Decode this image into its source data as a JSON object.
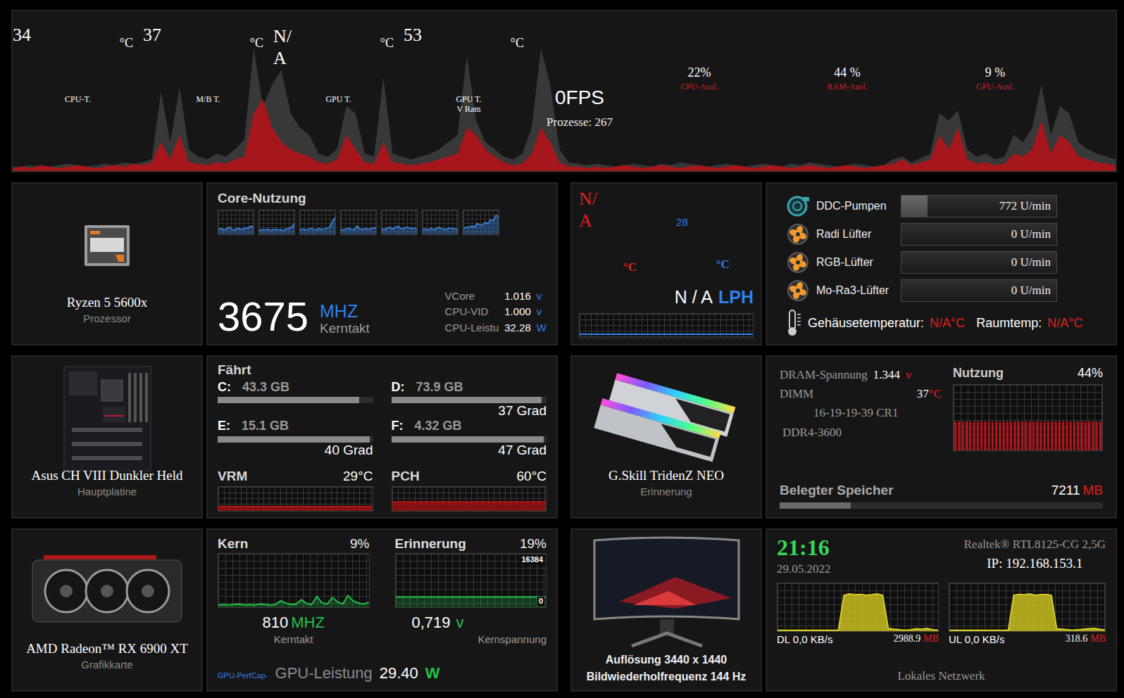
{
  "top": {
    "temps": [
      {
        "value": "34",
        "unit": "°C",
        "label": [
          "CPU-T."
        ],
        "kind": "plain"
      },
      {
        "value": "37",
        "unit": "°C",
        "label": [
          "M/B T."
        ],
        "kind": "plain"
      },
      {
        "value": "N/A",
        "unit": "°C",
        "label": [
          "GPU T."
        ],
        "kind": "stacked"
      },
      {
        "value": "53",
        "unit": "°C",
        "label": [
          "GPU T.",
          "V Ram"
        ],
        "kind": "plain"
      }
    ],
    "fps": "0FPS",
    "processes": "Prozesse: 267",
    "usage": [
      {
        "value": "22%",
        "label": "CPU-Ausl."
      },
      {
        "value": "44 %",
        "label": "RAM-Ausl."
      },
      {
        "value": "9 %",
        "label": "GPU-Ausl."
      }
    ],
    "chart": {
      "series": [
        {
          "color": "#3c3c3c",
          "values": [
            3,
            3,
            4,
            3,
            3,
            4,
            5,
            4,
            3,
            4,
            5,
            4,
            6,
            5,
            6,
            8,
            55,
            20,
            58,
            15,
            10,
            8,
            12,
            10,
            15,
            22,
            85,
            45,
            60,
            70,
            40,
            30,
            25,
            12,
            10,
            15,
            45,
            40,
            12,
            10,
            65,
            12,
            10,
            8,
            10,
            12,
            15,
            20,
            25,
            80,
            35,
            20,
            15,
            10,
            8,
            12,
            30,
            85,
            60,
            15,
            6,
            5,
            4,
            5,
            4,
            3,
            4,
            5,
            4,
            3,
            5,
            4,
            6,
            5,
            4,
            3,
            4,
            5,
            4,
            3,
            4,
            5,
            4,
            3,
            5,
            4,
            6,
            5,
            4,
            3,
            4,
            5,
            4,
            3,
            4,
            8,
            10,
            6,
            9,
            12,
            40,
            35,
            42,
            15,
            10,
            12,
            8,
            10,
            25,
            20,
            30,
            60,
            25,
            45,
            40,
            20,
            15,
            12,
            10,
            8
          ]
        },
        {
          "color": "#b3141a",
          "values": [
            2,
            3,
            2,
            4,
            3,
            2,
            3,
            4,
            3,
            2,
            3,
            4,
            3,
            5,
            4,
            6,
            20,
            8,
            25,
            6,
            5,
            4,
            6,
            5,
            8,
            10,
            40,
            50,
            30,
            20,
            15,
            12,
            10,
            6,
            5,
            8,
            25,
            15,
            6,
            5,
            20,
            6,
            5,
            4,
            5,
            6,
            8,
            10,
            12,
            30,
            25,
            15,
            10,
            6,
            4,
            5,
            12,
            30,
            20,
            6,
            3,
            3,
            2,
            3,
            2,
            3,
            4,
            3,
            2,
            3,
            4,
            3,
            2,
            3,
            4,
            3,
            2,
            3,
            4,
            3,
            2,
            3,
            4,
            3,
            2,
            3,
            4,
            3,
            2,
            3,
            4,
            3,
            2,
            3,
            4,
            5,
            8,
            4,
            6,
            8,
            25,
            15,
            30,
            8,
            5,
            6,
            4,
            5,
            12,
            10,
            15,
            35,
            12,
            25,
            20,
            10,
            8,
            6,
            5,
            4
          ]
        }
      ]
    }
  },
  "cpu": {
    "name": "Ryzen 5 5600x",
    "type": "Prozessor",
    "title": "Core-Nutzung",
    "cores": [
      {
        "values": [
          20,
          25,
          18,
          22,
          30,
          20,
          18,
          25,
          22,
          20,
          28,
          24,
          35,
          30
        ]
      },
      {
        "values": [
          15,
          20,
          18,
          22,
          17,
          19,
          21,
          18,
          20,
          16,
          22,
          25,
          30,
          45
        ]
      },
      {
        "values": [
          18,
          22,
          20,
          19,
          25,
          21,
          18,
          24,
          20,
          22,
          26,
          30,
          55,
          70
        ]
      },
      {
        "values": [
          20,
          18,
          22,
          25,
          20,
          18,
          35,
          22,
          20,
          24,
          21,
          23,
          28,
          25
        ]
      },
      {
        "values": [
          22,
          20,
          25,
          30,
          22,
          28,
          35,
          25,
          22,
          30,
          28,
          24,
          26,
          22
        ]
      },
      {
        "values": [
          20,
          22,
          18,
          25,
          20,
          22,
          30,
          24,
          20,
          22,
          26,
          24,
          22,
          20
        ]
      },
      {
        "values": [
          25,
          30,
          28,
          35,
          30,
          45,
          40,
          38,
          50,
          45,
          60,
          55,
          80,
          70
        ]
      }
    ],
    "clock": "3675",
    "clock_unit": "MHZ",
    "clock_label": "Kerntakt",
    "readings": [
      {
        "label": "VCore",
        "value": "1.016",
        "unit": "v"
      },
      {
        "label": "CPU-VID",
        "value": "1.000",
        "unit": "v"
      },
      {
        "label": "CPU-Leistu",
        "value": "32.28",
        "unit": "W"
      }
    ]
  },
  "cooling": {
    "temps": [
      {
        "value": "N/A",
        "unit": "°C",
        "color": "#e0201c",
        "kind": "stacked"
      },
      {
        "value": "28",
        "unit": "°C",
        "color": "#2f7ff0",
        "kind": "plain"
      }
    ],
    "flow": {
      "value": "N / A",
      "unit": "LPH"
    },
    "graph": [
      15,
      15,
      15,
      15,
      15,
      15,
      15,
      15,
      15,
      15,
      15,
      15,
      15,
      15,
      15,
      15
    ]
  },
  "fans": {
    "items": [
      {
        "name": "DDC-Pumpen",
        "reading": "772 U/min",
        "level": 0.17,
        "kind": "pump"
      },
      {
        "name": "Radi Lüfter",
        "reading": "0 U/min",
        "level": 0,
        "kind": "fan"
      },
      {
        "name": "RGB-Lüfter",
        "reading": "0 U/min",
        "level": 0,
        "kind": "fan"
      },
      {
        "name": "Mo-Ra3-Lüfter",
        "reading": "0 U/min",
        "level": 0,
        "kind": "fan"
      }
    ],
    "case_label": "Gehäusetemperatur:",
    "case_value": "N/A°C",
    "room_label": "Raumtemp:",
    "room_value": "N/A°C"
  },
  "board": {
    "name": "Asus CH VIII Dunkler Held",
    "type": "Hauptplatine",
    "drives_title": "Fährt",
    "drives": [
      {
        "letter": "C:",
        "size": "43.3 GB",
        "level": 0.91
      },
      {
        "letter": "D:",
        "size": "73.9 GB",
        "level": 0.97,
        "temp": "37 Grad"
      },
      {
        "letter": "E:",
        "size": "15.1 GB",
        "level": 0.98,
        "temp": "40 Grad"
      },
      {
        "letter": "F:",
        "size": "4.32 GB",
        "level": 0.98,
        "temp": "47 Grad"
      }
    ],
    "sensors": [
      {
        "label": "VRM",
        "value": "29°C",
        "values": [
          29,
          29,
          29,
          29,
          29,
          29,
          29,
          29,
          29,
          29,
          29,
          29,
          29,
          29,
          29,
          29
        ]
      },
      {
        "label": "PCH",
        "value": "60°C",
        "values": [
          60,
          60,
          60,
          60,
          60,
          60,
          60,
          60,
          60,
          60,
          60,
          60,
          60,
          60,
          60,
          60
        ]
      }
    ]
  },
  "ram": {
    "name": "G.Skill TridenZ NEO",
    "type": "Erinnerung",
    "voltage_label": "DRAM-Spannung",
    "voltage": "1.344",
    "voltage_unit": "v",
    "dimm_label": "DIMM",
    "dimm": "37",
    "dimm_unit": "°C",
    "timings": "16-19-19-39 CR1",
    "speed": "DDR4-3600",
    "usage_label": "Nutzung",
    "usage_value": "44%",
    "usage_values": [
      44,
      44,
      44,
      44,
      44,
      44,
      44,
      44,
      44,
      44,
      44,
      44,
      44,
      44,
      44,
      44,
      44,
      44,
      44,
      44,
      44,
      44,
      44,
      44,
      44,
      44,
      44,
      44,
      44,
      44,
      44,
      44,
      44,
      44,
      44,
      44,
      44,
      44,
      44,
      44
    ],
    "used_label": "Belegter Speicher",
    "used_value": "7211",
    "used_unit": "MB",
    "used_level": 0.22
  },
  "gpu": {
    "name": "AMD Radeon™ RX 6900 XT",
    "type": "Grafikkarte",
    "core": {
      "label": "Kern",
      "value": "9%",
      "values": [
        4,
        5,
        4,
        5,
        6,
        4,
        5,
        4,
        6,
        5,
        4,
        5,
        12,
        8,
        5,
        6,
        14,
        7,
        5,
        20,
        8,
        6,
        18,
        10,
        6,
        22,
        12,
        8,
        6,
        9
      ]
    },
    "memory": {
      "label": "Erinnerung",
      "value": "19%",
      "max": "16384",
      "min": "0",
      "values": [
        3113,
        3113,
        3113,
        3113,
        3113,
        3113,
        3113,
        3113,
        3113,
        3113,
        3113,
        3113,
        3113,
        3113,
        3113,
        3113,
        3113,
        3113,
        3113,
        3113
      ]
    },
    "clock": "810",
    "clock_unit": "MHZ",
    "clock_label": "Kerntakt",
    "voltage": "0,719",
    "voltage_unit": "v",
    "voltage_label": "Kernspannung",
    "perfcap": "GPU-PerfCap-",
    "power_label": "GPU-Leistung",
    "power": "29.40",
    "power_unit": "W"
  },
  "display": {
    "resolution": "Auflösung 3440 x 1440",
    "refresh": "Bildwiederholfrequenz 144 Hz"
  },
  "network": {
    "time": "21:16",
    "date": "29.05.2022",
    "adapter": "Realtek® RTL8125-CG 2,5G",
    "ip": "IP: 192.168.153.1",
    "down": {
      "rate": "DL 0,0 KB/s",
      "total": "2988.9",
      "unit": "MB",
      "values": [
        2,
        2,
        2,
        2,
        2,
        2,
        2,
        2,
        2,
        2,
        2,
        2,
        75,
        78,
        76,
        77,
        75,
        76,
        78,
        75,
        6,
        4,
        3,
        2,
        3,
        5,
        4,
        6,
        3,
        2
      ]
    },
    "up": {
      "rate": "UL 0,0 KB/s",
      "total": "318.6",
      "unit": "MB",
      "values": [
        2,
        2,
        2,
        2,
        2,
        2,
        2,
        2,
        2,
        2,
        2,
        2,
        75,
        77,
        76,
        78,
        75,
        76,
        77,
        75,
        5,
        4,
        3,
        2,
        3,
        4,
        5,
        6,
        4,
        2
      ]
    },
    "label": "Lokales Netzwerk"
  }
}
